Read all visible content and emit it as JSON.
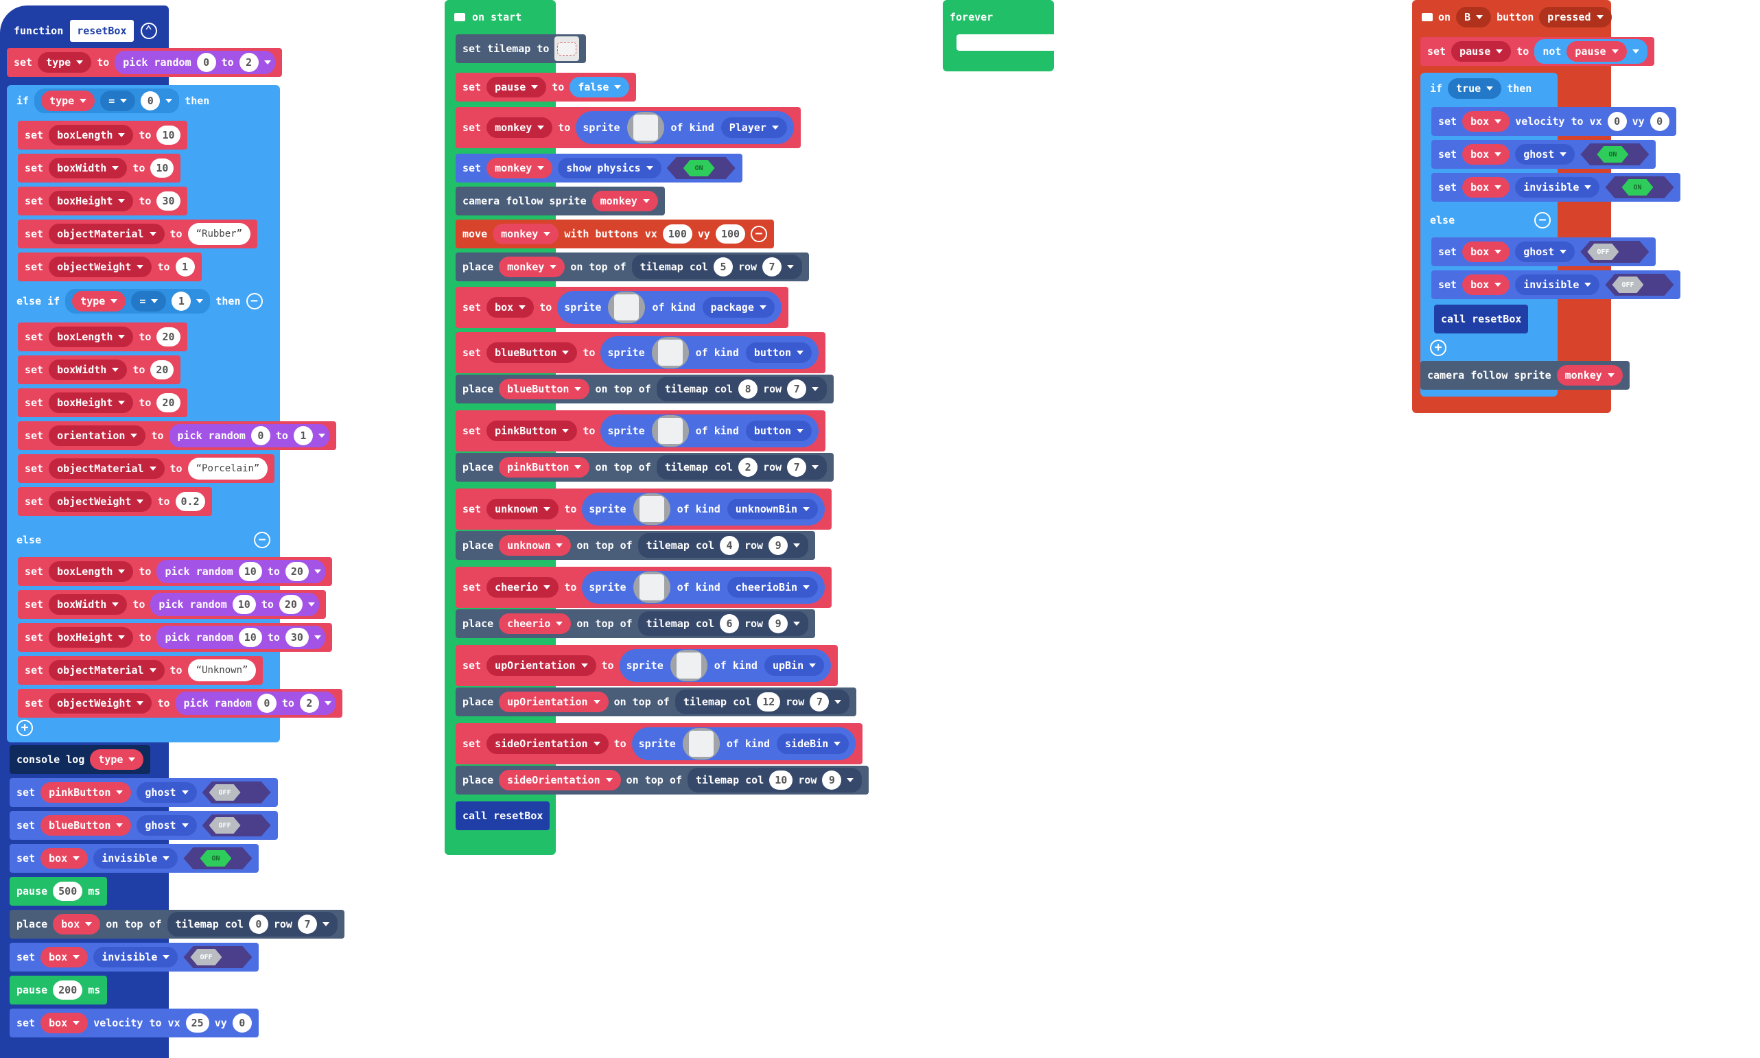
{
  "colors": {
    "variables": "#e8455f",
    "math": "#a354e6",
    "logic": "#42a5f5",
    "functions": "#1f3fa6",
    "loops": "#21bf68",
    "sprites": "#4b6fe3",
    "scene": "#4a5e7a",
    "console": "#0f2a5c",
    "controller": "#d8432b"
  },
  "function_block": {
    "keyword": "function",
    "name": "resetBox",
    "collapse_icon": "chevron-up-icon",
    "set1": {
      "kw": "set",
      "var": "type",
      "to": "to",
      "fn": "pick random",
      "a": "0",
      "mid": "to",
      "b": "2"
    },
    "if1": {
      "kw": "if",
      "var": "type",
      "op": "=",
      "val": "0",
      "then": "then"
    },
    "a_rows": [
      {
        "kw": "set",
        "var": "boxLength",
        "to": "to",
        "val": "10"
      },
      {
        "kw": "set",
        "var": "boxWidth",
        "to": "to",
        "val": "10"
      },
      {
        "kw": "set",
        "var": "boxHeight",
        "to": "to",
        "val": "30"
      },
      {
        "kw": "set",
        "var": "objectMaterial",
        "to": "to",
        "str": "Rubber"
      },
      {
        "kw": "set",
        "var": "objectWeight",
        "to": "to",
        "val": "1"
      }
    ],
    "elseif": {
      "kw": "else if",
      "var": "type",
      "op": "=",
      "val": "1",
      "then": "then"
    },
    "b_rows": [
      {
        "kw": "set",
        "var": "boxLength",
        "to": "to",
        "val": "20"
      },
      {
        "kw": "set",
        "var": "boxWidth",
        "to": "to",
        "val": "20"
      },
      {
        "kw": "set",
        "var": "boxHeight",
        "to": "to",
        "val": "20"
      },
      {
        "kw": "set",
        "var": "orientation",
        "to": "to",
        "fn": "pick random",
        "a": "0",
        "mid": "to",
        "b": "1"
      },
      {
        "kw": "set",
        "var": "objectMaterial",
        "to": "to",
        "str": "Porcelain"
      },
      {
        "kw": "set",
        "var": "objectWeight",
        "to": "to",
        "val": "0.2"
      }
    ],
    "else": "else",
    "c_rows": [
      {
        "kw": "set",
        "var": "boxLength",
        "to": "to",
        "fn": "pick random",
        "a": "10",
        "mid": "to",
        "b": "20"
      },
      {
        "kw": "set",
        "var": "boxWidth",
        "to": "to",
        "fn": "pick random",
        "a": "10",
        "mid": "to",
        "b": "20"
      },
      {
        "kw": "set",
        "var": "boxHeight",
        "to": "to",
        "fn": "pick random",
        "a": "10",
        "mid": "to",
        "b": "30"
      },
      {
        "kw": "set",
        "var": "objectMaterial",
        "to": "to",
        "str": "Unknown"
      },
      {
        "kw": "set",
        "var": "objectWeight",
        "to": "to",
        "fn": "pick random",
        "a": "0",
        "mid": "to",
        "b": "2"
      }
    ],
    "console": {
      "kw": "console log",
      "var": "type"
    },
    "ghost1": {
      "kw": "set",
      "var": "pinkButton",
      "prop": "ghost",
      "state": "OFF"
    },
    "ghost2": {
      "kw": "set",
      "var": "blueButton",
      "prop": "ghost",
      "state": "OFF"
    },
    "inv1": {
      "kw": "set",
      "var": "box",
      "prop": "invisible",
      "state": "ON"
    },
    "pause1": {
      "kw": "pause",
      "val": "500",
      "unit": "ms"
    },
    "place": {
      "kw": "place",
      "var": "box",
      "on": "on top of",
      "tm": "tilemap col",
      "col": "0",
      "row_kw": "row",
      "row": "7"
    },
    "inv2": {
      "kw": "set",
      "var": "box",
      "prop": "invisible",
      "state": "OFF"
    },
    "pause2": {
      "kw": "pause",
      "val": "200",
      "unit": "ms"
    },
    "vel": {
      "kw": "set",
      "var": "box",
      "v": "velocity to vx",
      "vx": "25",
      "vy_kw": "vy",
      "vy": "0"
    }
  },
  "on_start": {
    "hat": "on start",
    "tilemap": {
      "kw": "set tilemap to"
    },
    "pause": {
      "kw": "set",
      "var": "pause",
      "to": "to",
      "val": "false"
    },
    "monkey_set": {
      "kw": "set",
      "var": "monkey",
      "to": "to",
      "sprite": "sprite",
      "of": "of kind",
      "kind": "Player"
    },
    "physics": {
      "kw": "set",
      "var": "monkey",
      "prop": "show physics",
      "state": "ON"
    },
    "camera": {
      "kw": "camera follow sprite",
      "var": "monkey"
    },
    "move": {
      "kw": "move",
      "var": "monkey",
      "w": "with buttons vx",
      "vx": "100",
      "vy_kw": "vy",
      "vy": "100"
    },
    "place_monkey": {
      "kw": "place",
      "var": "monkey",
      "on": "on top of",
      "tm": "tilemap col",
      "col": "5",
      "row_kw": "row",
      "row": "7"
    },
    "box_set": {
      "kw": "set",
      "var": "box",
      "to": "to",
      "sprite": "sprite",
      "of": "of kind",
      "kind": "package"
    },
    "pairs": [
      {
        "set": {
          "kw": "set",
          "var": "blueButton",
          "to": "to",
          "sprite": "sprite",
          "of": "of kind",
          "kind": "button"
        },
        "place": {
          "kw": "place",
          "var": "blueButton",
          "on": "on top of",
          "tm": "tilemap col",
          "col": "8",
          "row_kw": "row",
          "row": "7"
        }
      },
      {
        "set": {
          "kw": "set",
          "var": "pinkButton",
          "to": "to",
          "sprite": "sprite",
          "of": "of kind",
          "kind": "button"
        },
        "place": {
          "kw": "place",
          "var": "pinkButton",
          "on": "on top of",
          "tm": "tilemap col",
          "col": "2",
          "row_kw": "row",
          "row": "7"
        }
      },
      {
        "set": {
          "kw": "set",
          "var": "unknown",
          "to": "to",
          "sprite": "sprite",
          "of": "of kind",
          "kind": "unknownBin"
        },
        "place": {
          "kw": "place",
          "var": "unknown",
          "on": "on top of",
          "tm": "tilemap col",
          "col": "4",
          "row_kw": "row",
          "row": "9"
        }
      },
      {
        "set": {
          "kw": "set",
          "var": "cheerio",
          "to": "to",
          "sprite": "sprite",
          "of": "of kind",
          "kind": "cheerioBin"
        },
        "place": {
          "kw": "place",
          "var": "cheerio",
          "on": "on top of",
          "tm": "tilemap col",
          "col": "6",
          "row_kw": "row",
          "row": "9"
        }
      },
      {
        "set": {
          "kw": "set",
          "var": "upOrientation",
          "to": "to",
          "sprite": "sprite",
          "of": "of kind",
          "kind": "upBin"
        },
        "place": {
          "kw": "place",
          "var": "upOrientation",
          "on": "on top of",
          "tm": "tilemap col",
          "col": "12",
          "row_kw": "row",
          "row": "7"
        }
      },
      {
        "set": {
          "kw": "set",
          "var": "sideOrientation",
          "to": "to",
          "sprite": "sprite",
          "of": "of kind",
          "kind": "sideBin"
        },
        "place": {
          "kw": "place",
          "var": "sideOrientation",
          "on": "on top of",
          "tm": "tilemap col",
          "col": "10",
          "row_kw": "row",
          "row": "9"
        }
      }
    ],
    "call": "call resetBox"
  },
  "forever": {
    "hat": "forever"
  },
  "on_button": {
    "hat": {
      "on": "on",
      "btn": "B",
      "button": "button",
      "event": "pressed"
    },
    "toggle": {
      "kw": "set",
      "var": "pause",
      "to": "to",
      "not": "not",
      "ref": "pause"
    },
    "if": {
      "kw": "if",
      "cond": "true",
      "then": "then"
    },
    "then_rows": [
      {
        "kw": "set",
        "var": "box",
        "v": "velocity to vx",
        "vx": "0",
        "vy_kw": "vy",
        "vy": "0"
      },
      {
        "kw": "set",
        "var": "box",
        "prop": "ghost",
        "state": "ON"
      },
      {
        "kw": "set",
        "var": "box",
        "prop": "invisible",
        "state": "ON"
      }
    ],
    "else": "else",
    "else_rows": [
      {
        "kw": "set",
        "var": "box",
        "prop": "ghost",
        "state": "OFF"
      },
      {
        "kw": "set",
        "var": "box",
        "prop": "invisible",
        "state": "OFF"
      }
    ],
    "call": "call resetBox",
    "camera": {
      "kw": "camera follow sprite",
      "var": "monkey"
    }
  }
}
